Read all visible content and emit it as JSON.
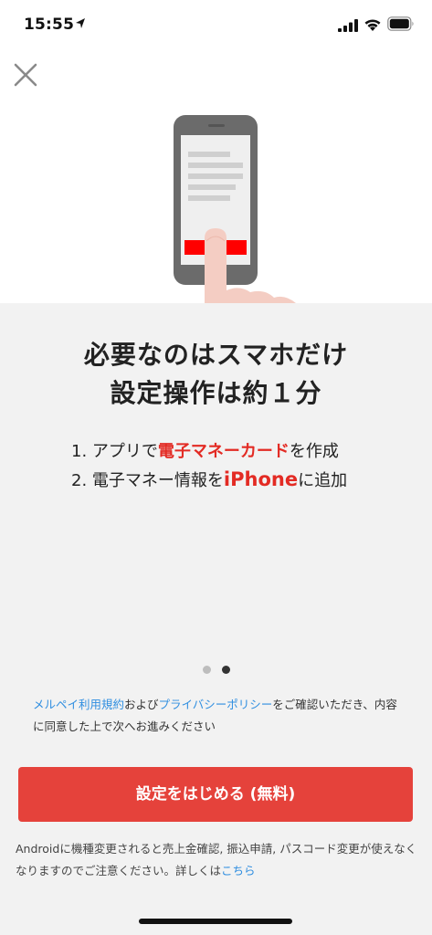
{
  "status_bar": {
    "time": "15:55",
    "icons": [
      "location-arrow-icon",
      "signal-bars-icon",
      "wifi-icon",
      "battery-icon"
    ]
  },
  "close_icon": "close-icon",
  "hero": {
    "illustration": "phone-tap-illustration",
    "accent_color": "#ff0000"
  },
  "headline": {
    "line1": "必要なのはスマホだけ",
    "line2": "設定操作は約１分"
  },
  "steps": {
    "step1_prefix": "1. アプリで",
    "step1_highlight": "電子マネーカード",
    "step1_suffix": "を作成",
    "step2_prefix": "2. 電子マネー情報を",
    "step2_highlight": "iPhone",
    "step2_suffix": "に追加"
  },
  "pagination": {
    "total": 2,
    "active_index": 1
  },
  "consent": {
    "terms_link": "メルペイ利用規約",
    "and_text": "および",
    "privacy_link": "プライバシーポリシー",
    "tail_text": "をご確認いただき、内容に同意した上で次へお進みください"
  },
  "cta": {
    "label": "設定をはじめる (無料)",
    "color": "#e5423b"
  },
  "notice": {
    "text": "Androidに機種変更されると売上金確認, 振込申請, パスコード変更が使えなくなりますのでご注意ください。詳しくは",
    "link": "こちら"
  },
  "colors": {
    "highlight": "#e32b24",
    "link": "#2f8ee0",
    "panel_background": "#f2f2f2"
  }
}
